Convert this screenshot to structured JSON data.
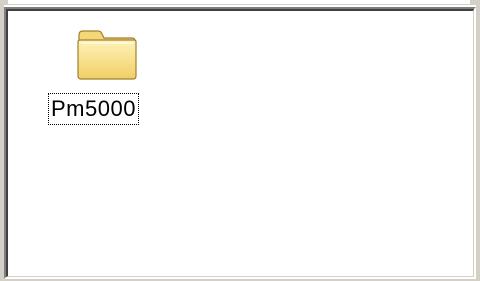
{
  "list_view": {
    "items": [
      {
        "label": "Pm5000",
        "icon": "folder-icon",
        "selected_focus": true
      }
    ]
  },
  "colors": {
    "folder_face": "#f8e08a",
    "folder_light": "#fff2b8",
    "folder_edge": "#a08030",
    "window_face": "#d4d0c8",
    "background": "#ffffff"
  }
}
